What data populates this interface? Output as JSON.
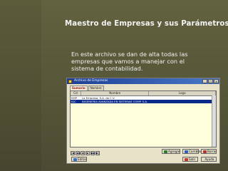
{
  "slide": {
    "title": "Maestro de Empresas y sus Parámetros.",
    "description": [
      "En este archivo se dan de alta todas las",
      "empresas que vamos a manejar con el",
      "sistema de contabilidad."
    ]
  },
  "window": {
    "title": "Archivo de Empresas",
    "controls": [
      "_",
      "□",
      "×"
    ],
    "tabs": [
      "Sumario",
      "Nombre"
    ],
    "grid": {
      "columns": [
        "Cd",
        "Nombre",
        "Logo"
      ],
      "rows": [
        [
          "EMP",
          "La Empresa, S.A. de C.V.",
          ""
        ],
        [
          "IGC",
          "INGENIERIA AVANZADA EN SISTEMAS COMP. S.A.",
          ""
        ]
      ],
      "selected_row": 1
    },
    "nav": [
      "|◀",
      "◀◀",
      "◀",
      "▶",
      "▶▶",
      "▶|"
    ],
    "buttons": {
      "agregar": "Agregar",
      "cambiar": "Cambiar",
      "borrar": "Borrar",
      "editar": "Editar",
      "salir": "Salir",
      "ayuda": "Ayuda"
    }
  },
  "colors": {
    "background": "#5a5a3e",
    "title_bar": "#1c3f95",
    "selected_row": "#0a2a8a",
    "grid_bg": "#ffffdc"
  }
}
